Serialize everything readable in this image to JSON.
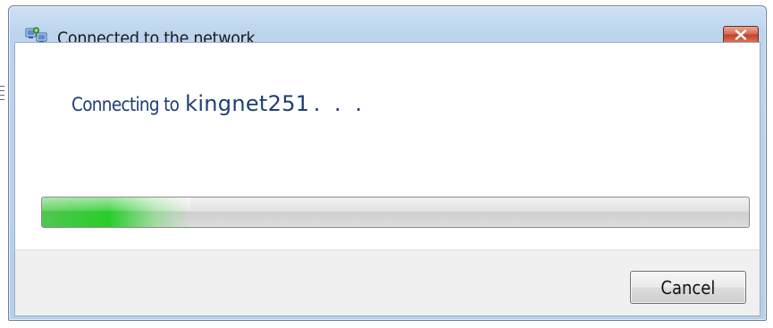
{
  "window": {
    "title": "Connected to the network",
    "title_icon": "network-connection-icon",
    "close_icon": "close-icon",
    "close_color": "#c0412a"
  },
  "status": {
    "prefix": "Connecting to",
    "network_name": "kingnet251",
    "ellipsis": ". . .",
    "text_color": "#1e3f73"
  },
  "progress": {
    "mode": "indeterminate marquee",
    "glow_fraction": 0.21,
    "glow_color": "#28cd28"
  },
  "buttons": {
    "cancel_label": "Cancel"
  }
}
